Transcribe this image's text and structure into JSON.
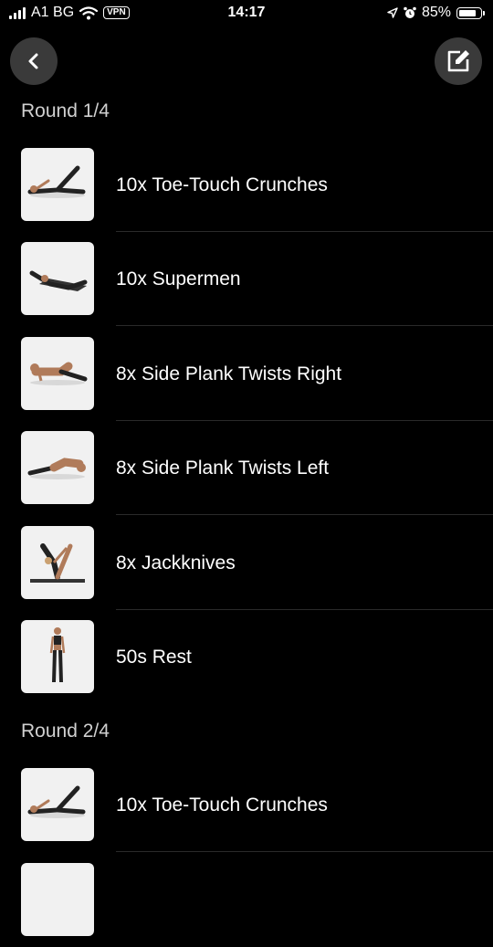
{
  "status_bar": {
    "carrier": "A1 BG",
    "vpn": "VPN",
    "time": "14:17",
    "battery": "85%",
    "battery_level": 0.85
  },
  "nav": {
    "back_icon": "chevron-left-icon",
    "edit_icon": "edit-icon"
  },
  "rounds": [
    {
      "title": "Round 1/4",
      "exercises": [
        {
          "label": "10x Toe-Touch Crunches",
          "image": "toe-touch-crunch"
        },
        {
          "label": "10x Supermen",
          "image": "supermen"
        },
        {
          "label": "8x Side Plank Twists Right",
          "image": "side-plank-right"
        },
        {
          "label": "8x Side Plank Twists Left",
          "image": "side-plank-left"
        },
        {
          "label": "8x Jackknives",
          "image": "jackknife"
        },
        {
          "label": "50s Rest",
          "image": "rest-standing"
        }
      ]
    },
    {
      "title": "Round 2/4",
      "exercises": [
        {
          "label": "10x Toe-Touch Crunches",
          "image": "toe-touch-crunch"
        }
      ]
    }
  ]
}
